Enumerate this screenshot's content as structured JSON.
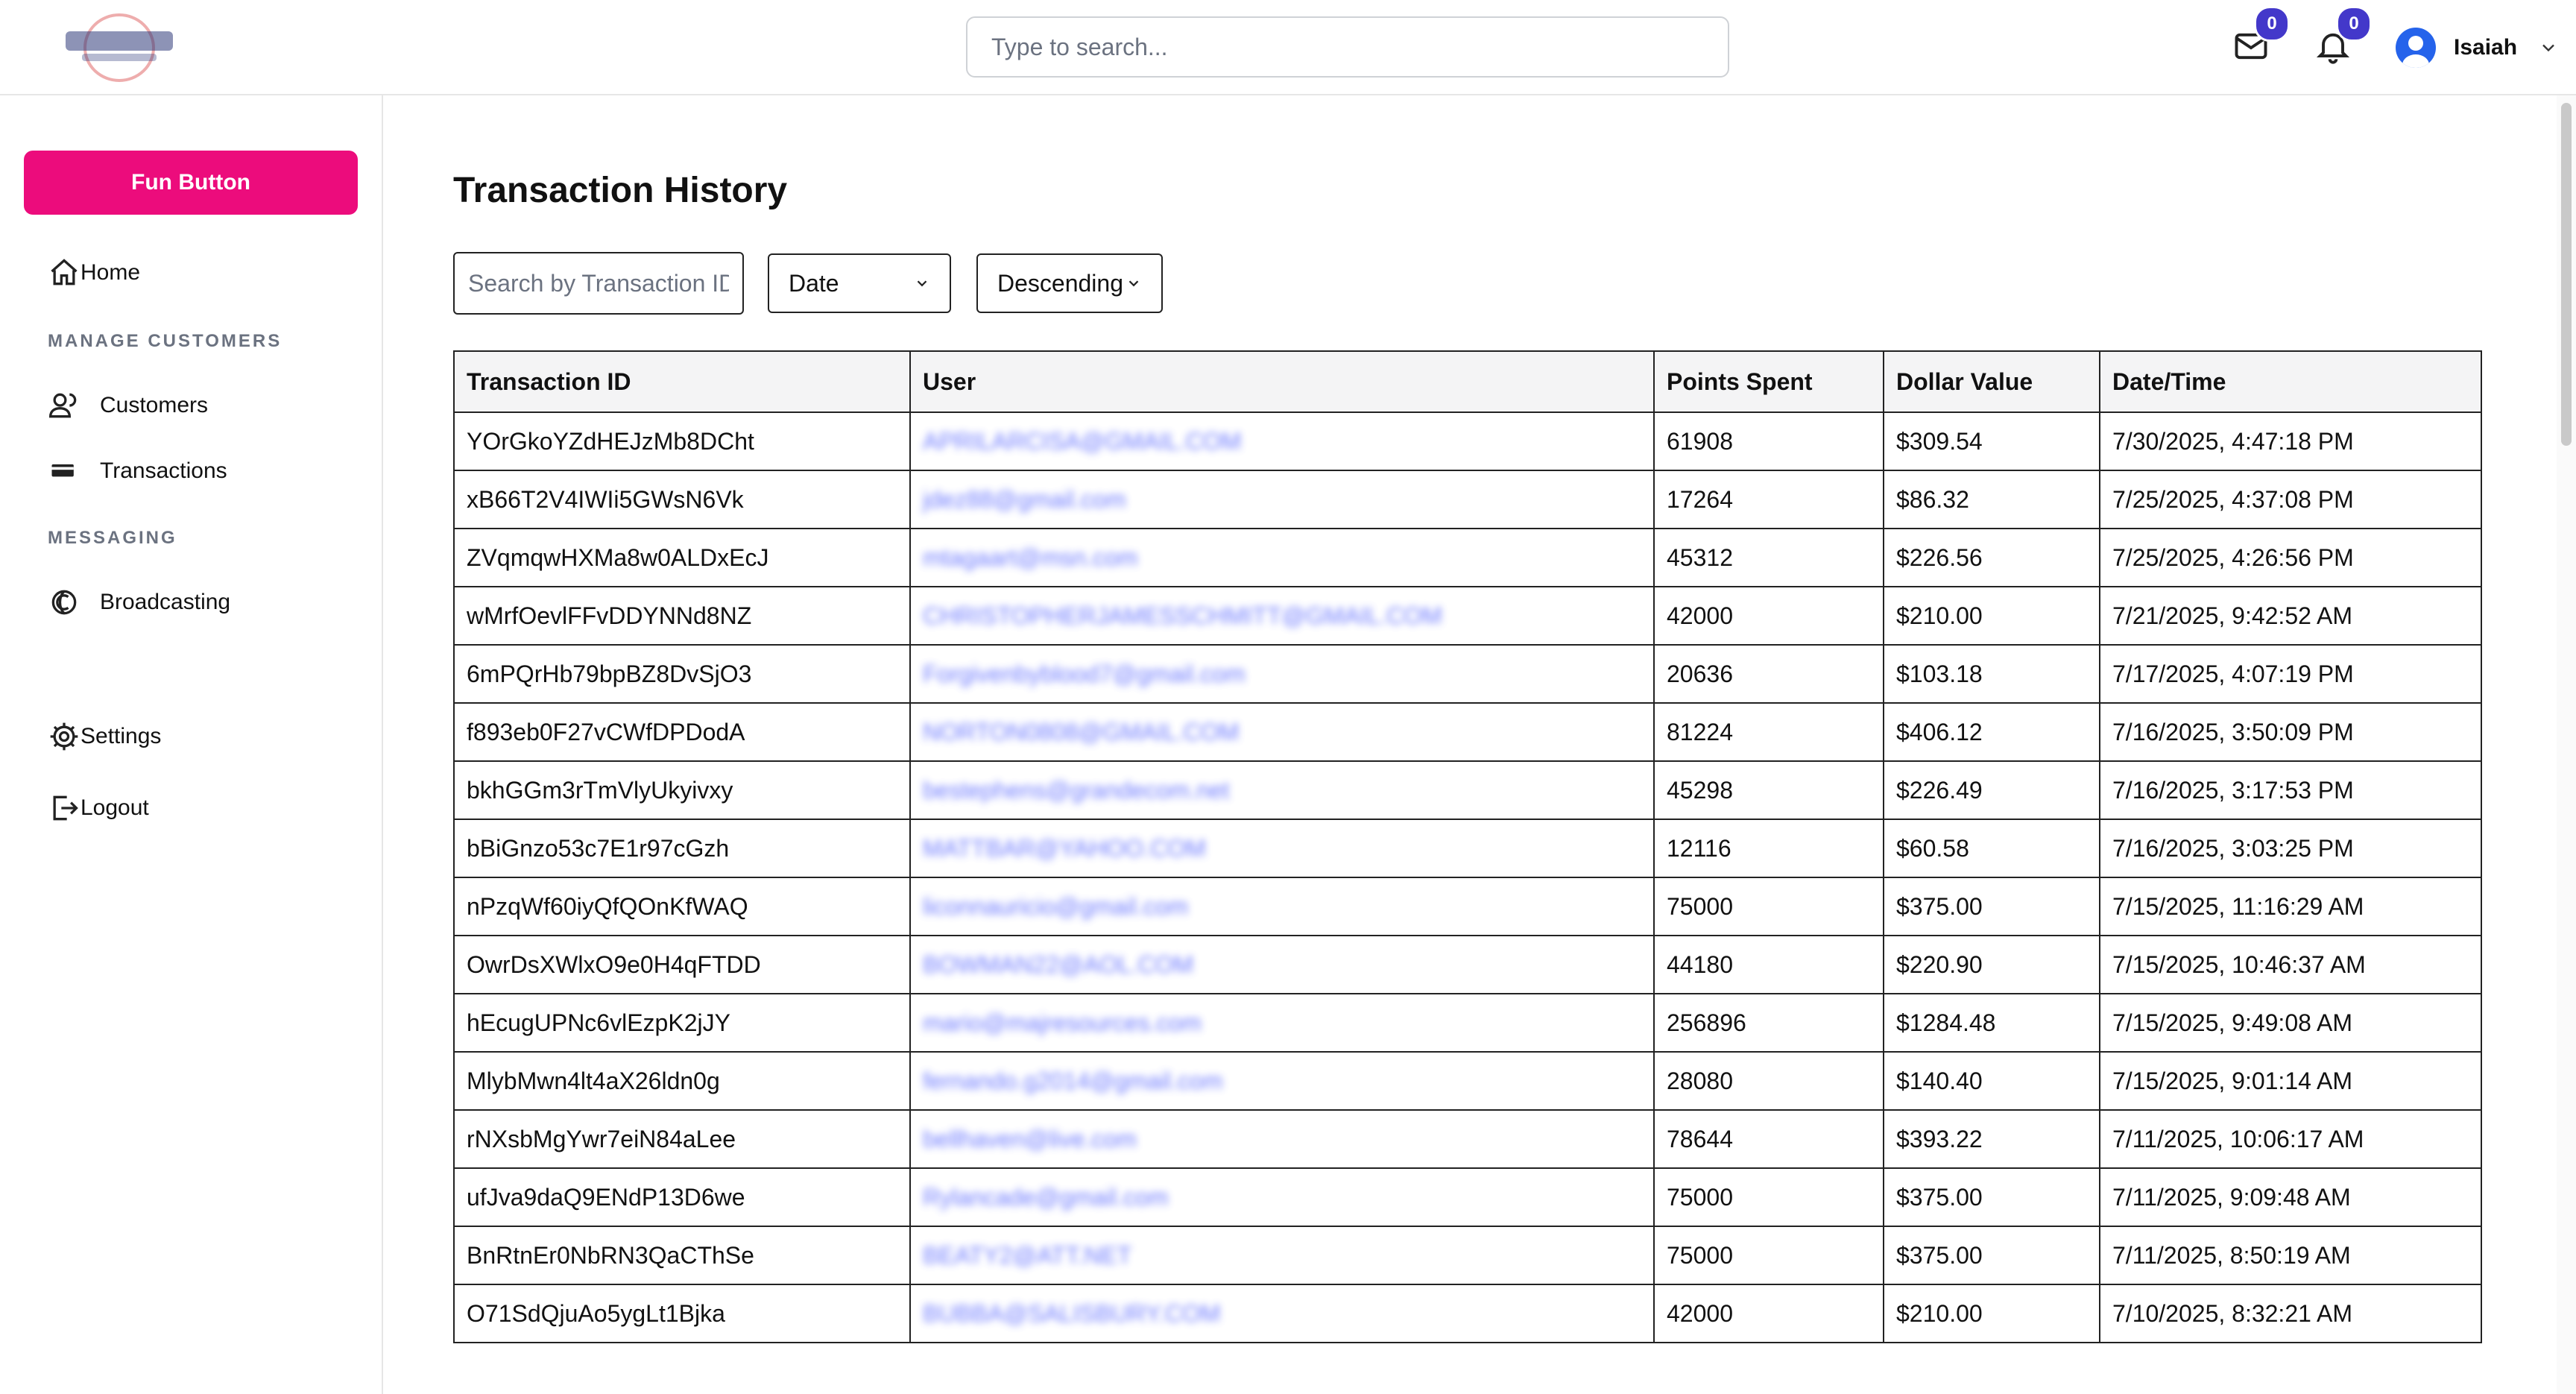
{
  "header": {
    "search_placeholder": "Type to search...",
    "mail_count": "0",
    "notification_count": "0",
    "user_name": "Isaiah"
  },
  "sidebar": {
    "fun_button": "Fun Button",
    "home": "Home",
    "section_manage": "MANAGE CUSTOMERS",
    "customers": "Customers",
    "transactions": "Transactions",
    "section_messaging": "MESSAGING",
    "broadcasting": "Broadcasting",
    "settings": "Settings",
    "logout": "Logout"
  },
  "main": {
    "title": "Transaction History",
    "search_placeholder": "Search by Transaction ID",
    "sort_field": "Date",
    "sort_order": "Descending",
    "columns": [
      "Transaction ID",
      "User",
      "Points Spent",
      "Dollar Value",
      "Date/Time"
    ],
    "rows": [
      [
        "YOrGkoYZdHEJzMb8DCht",
        "APRILARCISA@GMAIL.COM",
        "61908",
        "$309.54",
        "7/30/2025, 4:47:18 PM"
      ],
      [
        "xB66T2V4IWIi5GWsN6Vk",
        "jdez88@gmail.com",
        "17264",
        "$86.32",
        "7/25/2025, 4:37:08 PM"
      ],
      [
        "ZVqmqwHXMa8w0ALDxEcJ",
        "mtagaart@msn.com",
        "45312",
        "$226.56",
        "7/25/2025, 4:26:56 PM"
      ],
      [
        "wMrfOevlFFvDDYNNd8NZ",
        "CHRISTOPHERJAMESSCHMITT@GMAIL.COM",
        "42000",
        "$210.00",
        "7/21/2025, 9:42:52 AM"
      ],
      [
        "6mPQrHb79bpBZ8DvSjO3",
        "Forgivenbyblood7@gmail.com",
        "20636",
        "$103.18",
        "7/17/2025, 4:07:19 PM"
      ],
      [
        "f893eb0F27vCWfDPDodA",
        "NORTON0808@GMAIL.COM",
        "81224",
        "$406.12",
        "7/16/2025, 3:50:09 PM"
      ],
      [
        "bkhGGm3rTmVlyUkyivxy",
        "bestephens@grandecom.net",
        "45298",
        "$226.49",
        "7/16/2025, 3:17:53 PM"
      ],
      [
        "bBiGnzo53c7E1r97cGzh",
        "MATTBAR@YAHOO.COM",
        "12116",
        "$60.58",
        "7/16/2025, 3:03:25 PM"
      ],
      [
        "nPzqWf60iyQfQOnKfWAQ",
        "liconnauricio@gmail.com",
        "75000",
        "$375.00",
        "7/15/2025, 11:16:29 AM"
      ],
      [
        "OwrDsXWlxO9e0H4qFTDD",
        "BOWMAN22@AOL.COM",
        "44180",
        "$220.90",
        "7/15/2025, 10:46:37 AM"
      ],
      [
        "hEcugUPNc6vlEzpK2jJY",
        "mario@majresources.com",
        "256896",
        "$1284.48",
        "7/15/2025, 9:49:08 AM"
      ],
      [
        "MlybMwn4lt4aX26ldn0g",
        "fernando.g2014@gmail.com",
        "28080",
        "$140.40",
        "7/15/2025, 9:01:14 AM"
      ],
      [
        "rNXsbMgYwr7eiN84aLee",
        "bellhaven@live.com",
        "78644",
        "$393.22",
        "7/11/2025, 10:06:17 AM"
      ],
      [
        "ufJva9daQ9ENdP13D6we",
        "Rylancade@gmail.com",
        "75000",
        "$375.00",
        "7/11/2025, 9:09:48 AM"
      ],
      [
        "BnRtnEr0NbRN3QaCThSe",
        "BEATY2@ATT.NET",
        "75000",
        "$375.00",
        "7/11/2025, 8:50:19 AM"
      ],
      [
        "O71SdQjuAo5ygLt1Bjka",
        "BUBBA@SALISBURY.COM",
        "42000",
        "$210.00",
        "7/10/2025, 8:32:21 AM"
      ]
    ]
  },
  "colors": {
    "accent_pink": "#ec0c7c",
    "badge": "#4338ca",
    "avatar": "#2563eb"
  }
}
